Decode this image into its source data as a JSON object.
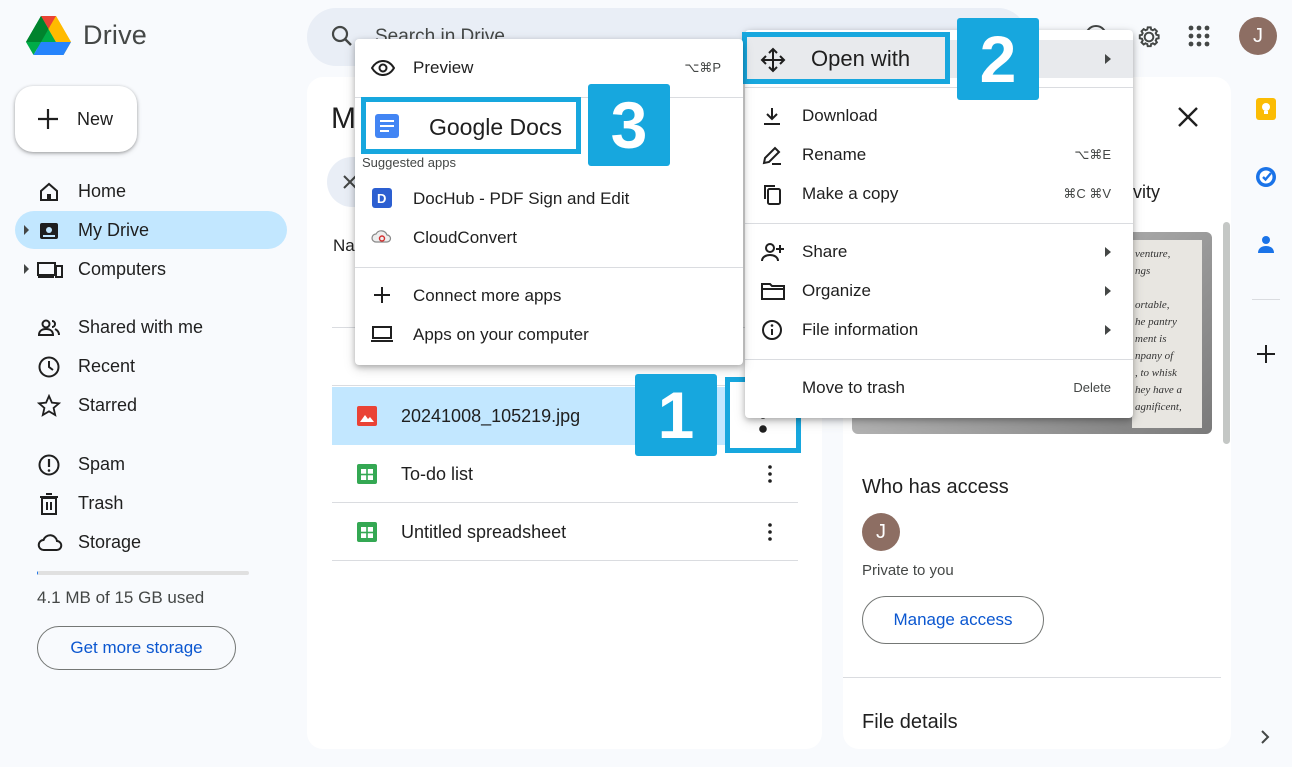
{
  "header": {
    "app_name": "Drive",
    "search_placeholder": "Search in Drive",
    "avatar_initial": "J"
  },
  "sidebar": {
    "new_label": "New",
    "items": [
      {
        "label": "Home",
        "icon": "home-icon"
      },
      {
        "label": "My Drive",
        "icon": "my-drive-icon",
        "active": true
      },
      {
        "label": "Computers",
        "icon": "computers-icon"
      },
      {
        "label": "Shared with me",
        "icon": "shared-icon"
      },
      {
        "label": "Recent",
        "icon": "clock-icon"
      },
      {
        "label": "Starred",
        "icon": "star-icon"
      },
      {
        "label": "Spam",
        "icon": "spam-icon"
      },
      {
        "label": "Trash",
        "icon": "trash-icon"
      },
      {
        "label": "Storage",
        "icon": "cloud-icon"
      }
    ],
    "storage_text": "4.1 MB of 15 GB used",
    "storage_used_fraction": 0.0003,
    "storage_button": "Get more storage"
  },
  "main": {
    "title_partial": "M",
    "column_partial": "Na",
    "files": [
      {
        "name": "20241008_105219.jpg",
        "type": "image",
        "selected": true
      },
      {
        "name": "To-do list",
        "type": "sheet"
      },
      {
        "name": "Untitled spreadsheet",
        "type": "sheet"
      }
    ]
  },
  "right_panel": {
    "tab_partial": "vity",
    "preview_text": [
      "venture,",
      "ngs",
      "",
      "ortable,",
      "he pantry",
      "ment is",
      "npany of",
      ", to whisk",
      "hey have a",
      "agnificent,"
    ],
    "who_has_access": "Who has access",
    "avatar_initial": "J",
    "private_text": "Private to you",
    "manage_access": "Manage access",
    "file_details": "File details"
  },
  "context_menu": {
    "open_with": "Open with",
    "download": "Download",
    "rename": "Rename",
    "rename_shortcut": "⌥⌘E",
    "make_copy": "Make a copy",
    "make_copy_shortcut": "⌘C ⌘V",
    "share": "Share",
    "organize": "Organize",
    "file_information": "File information",
    "move_to_trash": "Move to trash",
    "move_to_trash_shortcut": "Delete"
  },
  "open_with_menu": {
    "preview": "Preview",
    "preview_shortcut": "⌥⌘P",
    "google_docs": "Google Docs",
    "suggested_apps": "Suggested apps",
    "dochub": "DocHub - PDF Sign and Edit",
    "cloudconvert": "CloudConvert",
    "connect_more": "Connect more apps",
    "apps_on_computer": "Apps on your computer"
  },
  "callouts": {
    "step1": "1",
    "step2": "2",
    "step3": "3",
    "color": "#17a7de"
  }
}
